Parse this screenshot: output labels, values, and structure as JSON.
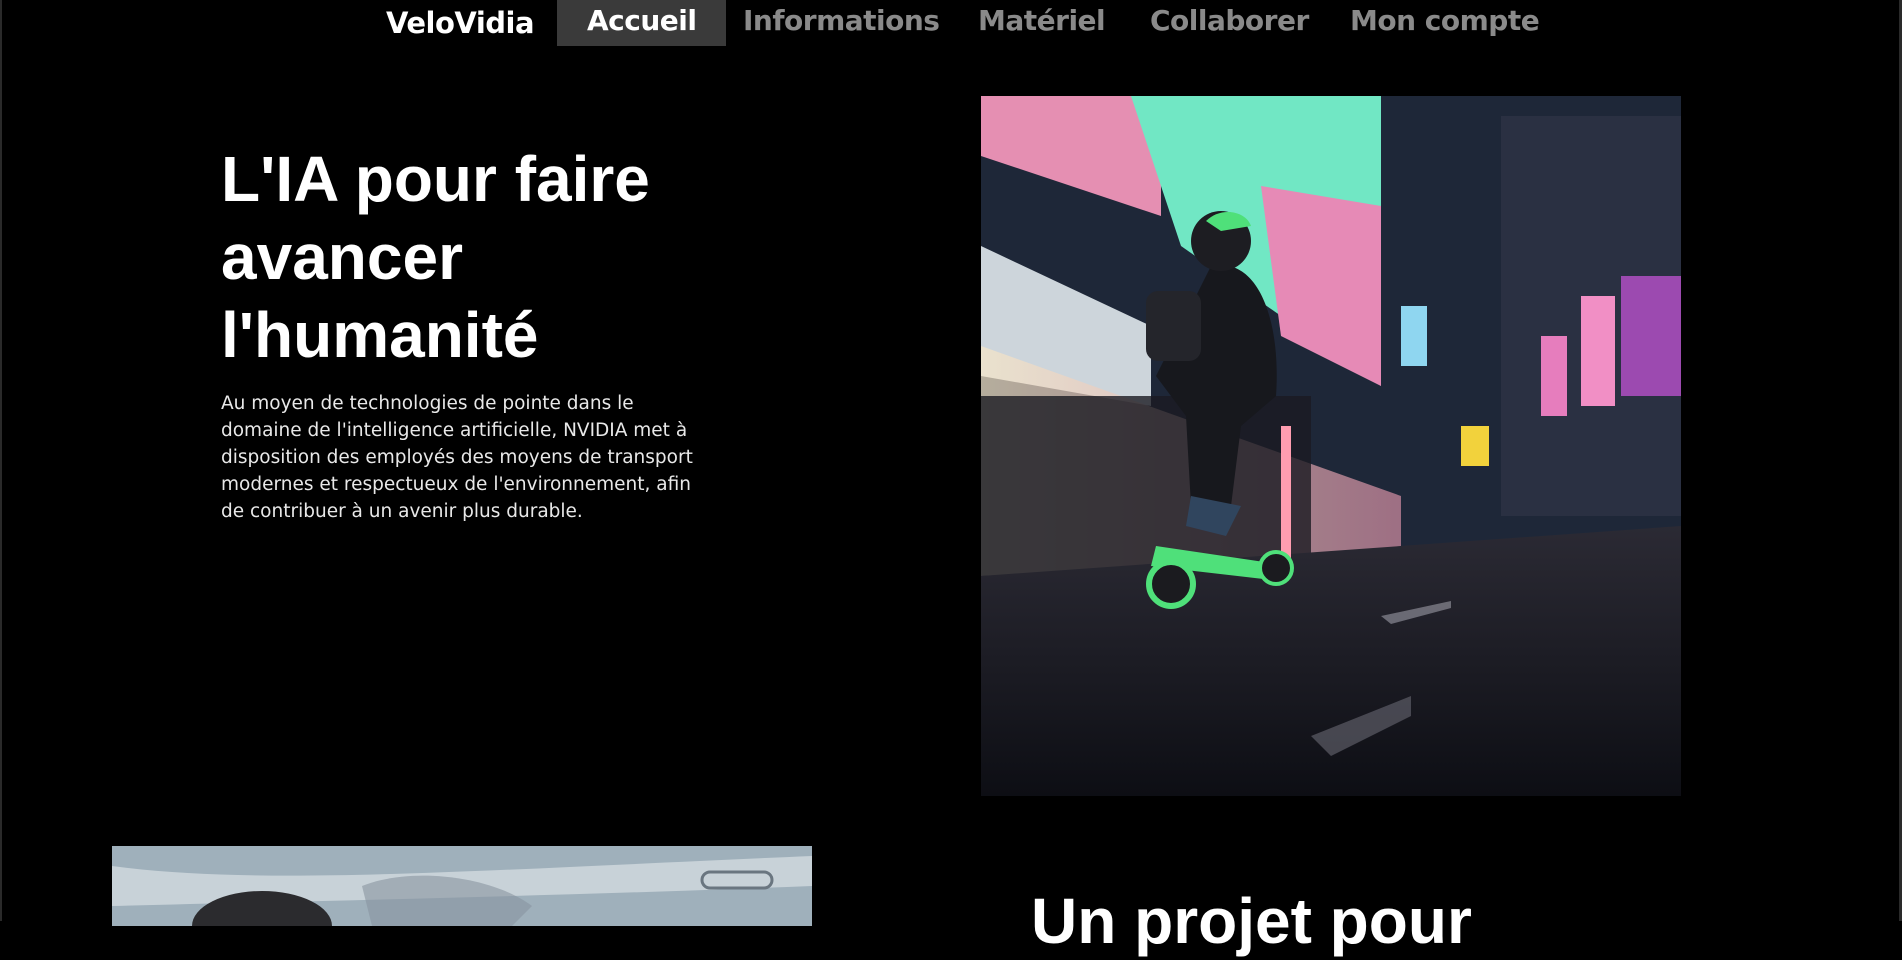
{
  "brand": "VeloVidia",
  "nav": {
    "items": [
      {
        "label": "Accueil",
        "active": true
      },
      {
        "label": "Informations",
        "active": false
      },
      {
        "label": "Matériel",
        "active": false
      },
      {
        "label": "Collaborer",
        "active": false
      },
      {
        "label": "Mon compte",
        "active": false
      }
    ]
  },
  "hero": {
    "title": "L'IA pour faire avancer l'humanité",
    "description": "Au moyen de technologies de pointe dans le domaine de l'intelligence artificielle, NVIDIA met à disposition des employés des moyens de transport modernes et respectueux de l'environnement, afin de contribuer à un avenir plus durable.",
    "image_alt": "Illustration d'une personne casquée sur une trottinette électrique verte dans une rue de ville néon la nuit"
  },
  "section2": {
    "title": "Un projet pour",
    "image_alt": "Photo de l'intérieur d'un véhicule"
  }
}
